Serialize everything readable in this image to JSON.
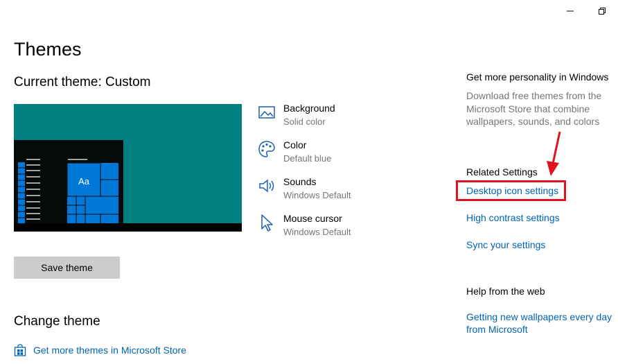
{
  "window": {
    "minimize_icon": "minimize-icon",
    "restore_icon": "restore-icon"
  },
  "page": {
    "title": "Themes",
    "current_theme": "Current theme: Custom"
  },
  "preview": {
    "sample_text": "Aa",
    "background_color": "#008080",
    "accent_color": "#0078d7"
  },
  "attributes": [
    {
      "icon": "picture-icon",
      "title": "Background",
      "value": "Solid color"
    },
    {
      "icon": "palette-icon",
      "title": "Color",
      "value": "Default blue"
    },
    {
      "icon": "speaker-icon",
      "title": "Sounds",
      "value": "Windows Default"
    },
    {
      "icon": "cursor-icon",
      "title": "Mouse cursor",
      "value": "Windows Default"
    }
  ],
  "save_theme_label": "Save theme",
  "change_theme": {
    "heading": "Change theme",
    "store_link": "Get more themes in Microsoft Store",
    "store_icon": "store-bag-icon"
  },
  "sidebar": {
    "personality_heading": "Get more personality in Windows",
    "personality_desc": "Download free themes from the Microsoft Store that combine wallpapers, sounds, and colors",
    "related_heading": "Related Settings",
    "related_links": [
      "Desktop icon settings",
      "High contrast settings",
      "Sync your settings"
    ],
    "help_heading": "Help from the web",
    "help_link": "Getting new wallpapers every day from Microsoft"
  },
  "annotation": {
    "highlight_color": "#e0141e"
  }
}
